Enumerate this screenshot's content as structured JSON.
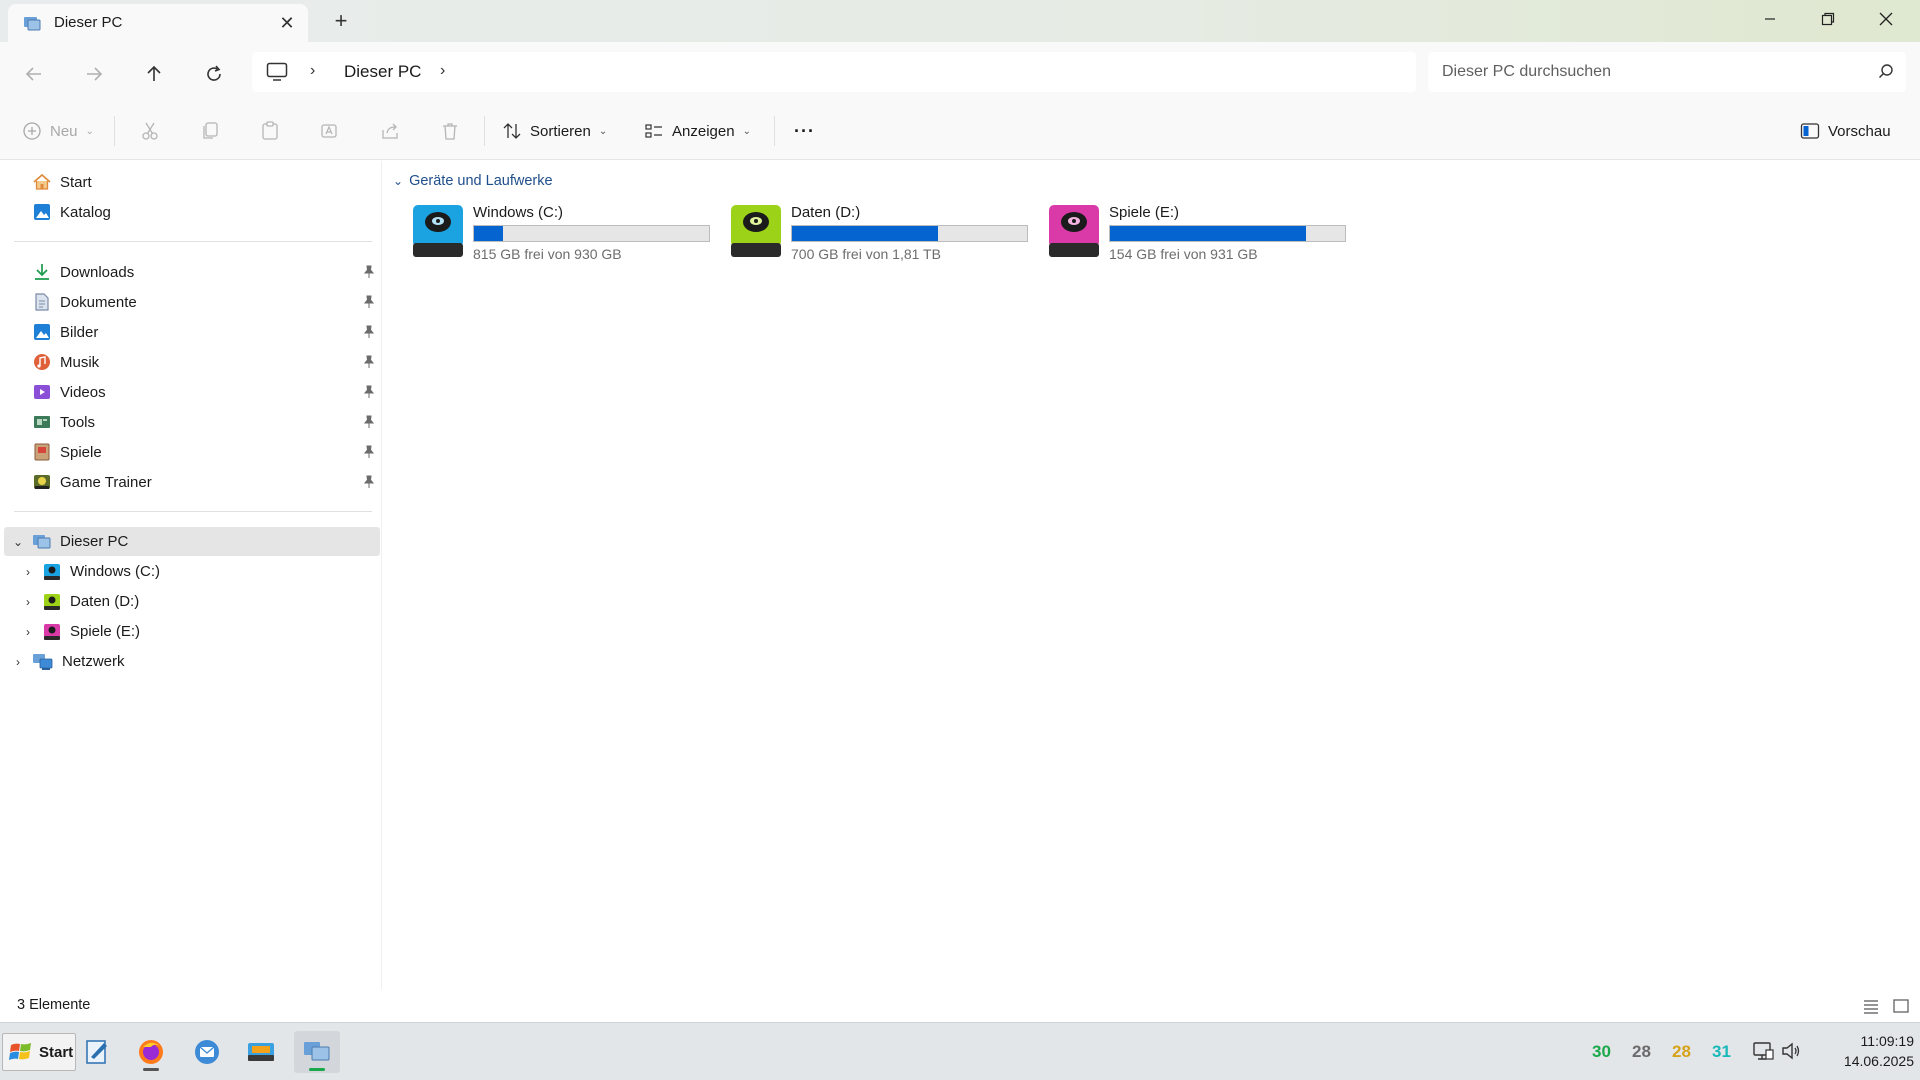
{
  "window": {
    "tab_title": "Dieser PC",
    "new_tab": "+",
    "close_tab": "✕"
  },
  "address": {
    "crumb": "Dieser PC",
    "search_placeholder": "Dieser PC durchsuchen"
  },
  "toolbar": {
    "new_label": "Neu",
    "sort_label": "Sortieren",
    "view_label": "Anzeigen",
    "more_label": "···",
    "preview_label": "Vorschau"
  },
  "sidebar": {
    "top": [
      {
        "label": "Start",
        "icon": "home-icon"
      },
      {
        "label": "Katalog",
        "icon": "gallery-icon"
      }
    ],
    "quick": [
      {
        "label": "Downloads",
        "icon": "download-icon",
        "color": "#1a9c4b"
      },
      {
        "label": "Dokumente",
        "icon": "document-icon",
        "color": "#7a8aa6"
      },
      {
        "label": "Bilder",
        "icon": "pictures-icon",
        "color": "#1e7fd6"
      },
      {
        "label": "Musik",
        "icon": "music-icon",
        "color": "#e0603a"
      },
      {
        "label": "Videos",
        "icon": "video-icon",
        "color": "#8a4fd6"
      },
      {
        "label": "Tools",
        "icon": "tools-icon",
        "color": "#3c7a5a"
      },
      {
        "label": "Spiele",
        "icon": "games-icon",
        "color": "#8a5a3a"
      },
      {
        "label": "Game Trainer",
        "icon": "trainer-icon",
        "color": "#5a6b2a"
      }
    ],
    "tree": {
      "pc": "Dieser PC",
      "drives": [
        "Windows (C:)",
        "Daten (D:)",
        "Spiele (E:)"
      ],
      "network": "Netzwerk"
    }
  },
  "main": {
    "group_label": "Geräte und Laufwerke",
    "drives": [
      {
        "name": "Windows (C:)",
        "free": "815 GB frei von 930 GB",
        "used_fraction": 0.124,
        "color": "#1aa3e0"
      },
      {
        "name": "Daten (D:)",
        "free": "700 GB frei von 1,81 TB",
        "used_fraction": 0.622,
        "color": "#9cd318"
      },
      {
        "name": "Spiele (E:)",
        "free": "154 GB frei von 931 GB",
        "used_fraction": 0.835,
        "color": "#d93aa8"
      }
    ]
  },
  "status": {
    "count": "3 Elemente"
  },
  "taskbar": {
    "start_label": "Start",
    "temps": [
      {
        "value": "30",
        "color": "#1aa84a"
      },
      {
        "value": "28",
        "color": "#6b6b6b"
      },
      {
        "value": "28",
        "color": "#d6a21a"
      },
      {
        "value": "31",
        "color": "#1ab8b8"
      }
    ],
    "time": "11:09:19",
    "date": "14.06.2025"
  }
}
